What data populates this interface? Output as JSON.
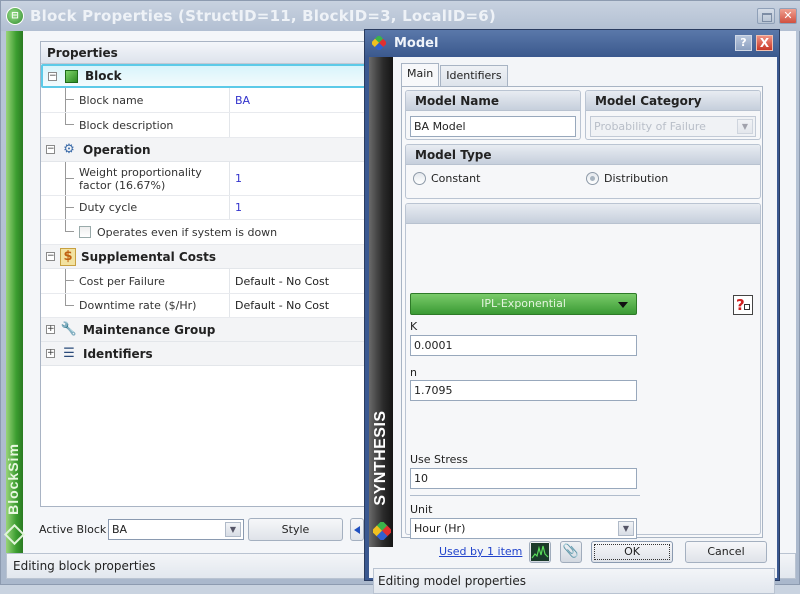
{
  "main_window": {
    "title": "Block Properties (StructID=11, BlockID=3, LocalID=6)",
    "brand": "BlockSim",
    "property_grid": {
      "header": "Properties",
      "categories": [
        {
          "label": "Block",
          "icon": "cube-icon",
          "expanded": true,
          "selected": true,
          "rows": [
            {
              "name": "Block name",
              "value": "BA"
            },
            {
              "name": "Block description",
              "value": ""
            }
          ]
        },
        {
          "label": "Operation",
          "icon": "gear-clock-icon",
          "expanded": true,
          "rows": [
            {
              "name": "Weight proportionality factor (16.67%)",
              "value": "1"
            },
            {
              "name": "Duty cycle",
              "value": "1"
            },
            {
              "name": "Operates even if system is down",
              "checked": false
            }
          ]
        },
        {
          "label": "Supplemental Costs",
          "icon": "dollar-icon",
          "expanded": true,
          "rows": [
            {
              "name": "Cost per Failure",
              "value": "Default - No Cost"
            },
            {
              "name": "Downtime rate ($/Hr)",
              "value": "Default - No Cost"
            }
          ]
        },
        {
          "label": "Maintenance Group",
          "icon": "maintenance-icon",
          "expanded": false
        },
        {
          "label": "Identifiers",
          "icon": "list-icon",
          "expanded": false
        }
      ]
    },
    "active_block_label": "Active Block",
    "active_block_value": "BA",
    "style_button": "Style",
    "status": "Editing block properties"
  },
  "model_dialog": {
    "title": "Model",
    "brand": "SYNTHESIS",
    "help_button": "?",
    "close_button": "X",
    "tabs": [
      {
        "label": "Main",
        "active": true
      },
      {
        "label": "Identifiers",
        "active": false
      }
    ],
    "model_name": {
      "header": "Model Name",
      "value": "BA Model"
    },
    "model_category": {
      "header": "Model Category",
      "value": "Probability of Failure",
      "disabled": true
    },
    "model_type": {
      "header": "Model Type",
      "options": [
        {
          "label": "Constant",
          "selected": false
        },
        {
          "label": "Distribution",
          "selected": true
        }
      ]
    },
    "distribution": "IPL-Exponential",
    "params": [
      {
        "label": "K",
        "value": "0.0001"
      },
      {
        "label": "n",
        "value": "1.7095"
      }
    ],
    "use_stress": {
      "label": "Use Stress",
      "value": "10"
    },
    "unit": {
      "label": "Unit",
      "value": "Hour (Hr)"
    },
    "used_by_link": "Used by 1 item",
    "ok_button": "OK",
    "cancel_button": "Cancel",
    "status": "Editing model properties"
  }
}
